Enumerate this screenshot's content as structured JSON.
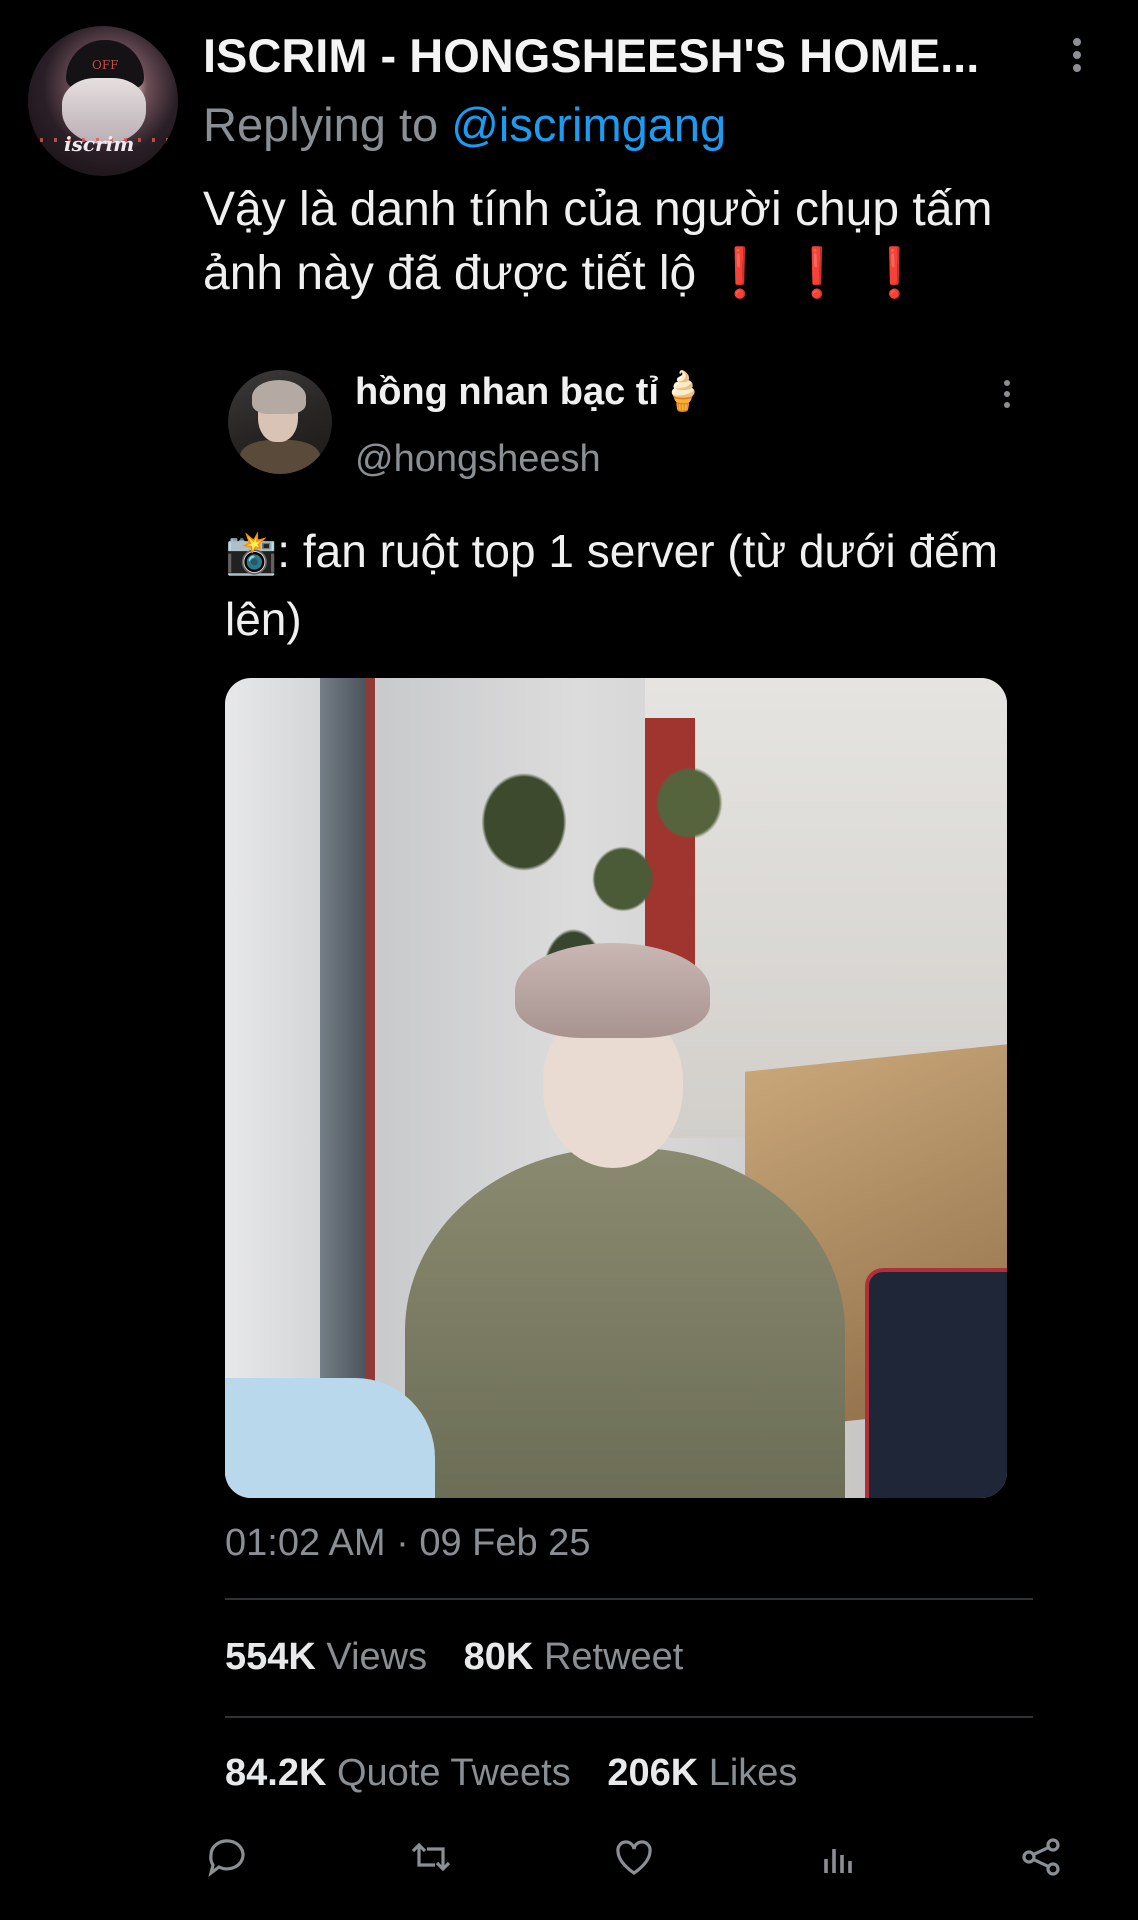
{
  "tweet": {
    "author_name": "ISCRIM - HONGSHEESH'S HOME...",
    "avatar_text": "iscrim",
    "avatar_hat_text": "OFF",
    "replying_prefix": "Replying to",
    "replying_handle": "@iscrimgang",
    "text": "Vậy là danh tính của người chụp tấm ảnh này đã được tiết lộ",
    "emphasis": "❗ ❗ ❗"
  },
  "quoted": {
    "name": "hồng nhan bạc tỉ🍦",
    "handle": "@hongsheesh",
    "camera_emoji": "📸",
    "text": ": fan ruột top 1 server (từ dưới đếm lên)",
    "timestamp": "01:02 AM · 09 Feb 25"
  },
  "stats": {
    "views_count": "554K",
    "views_label": "Views",
    "retweets_count": "80K",
    "retweets_label": "Retweet",
    "quotes_count": "84.2K",
    "quotes_label": "Quote Tweets",
    "likes_count": "206K",
    "likes_label": "Likes"
  },
  "actions": [
    "reply-icon",
    "retweet-icon",
    "like-icon",
    "analytics-icon",
    "share-icon"
  ],
  "colors": {
    "accent": "#1d9bf0",
    "secondary_text": "#8a8f94",
    "alert": "#e0182b"
  }
}
